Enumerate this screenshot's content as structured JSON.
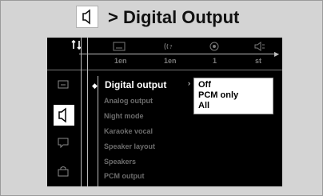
{
  "header": {
    "icon": "speaker-icon",
    "title": "> Digital Output"
  },
  "topbar": {
    "settings_icon": "settings-icon",
    "tabs": [
      {
        "icon": "subtitle-icon",
        "value": "1en"
      },
      {
        "icon": "audio-icon",
        "value": "1en"
      },
      {
        "icon": "angle-icon",
        "value": "1"
      },
      {
        "icon": "sound-icon",
        "value": "st"
      }
    ]
  },
  "sidebar": {
    "items": [
      {
        "icon": "display-icon",
        "selected": false
      },
      {
        "icon": "speaker-icon",
        "selected": true
      },
      {
        "icon": "subtitle-language-icon",
        "selected": false
      },
      {
        "icon": "lock-icon",
        "selected": false
      }
    ]
  },
  "menu": {
    "items": [
      "Digital output",
      "Analog output",
      "Night mode",
      "Karaoke vocal",
      "Speaker layout",
      "Speakers",
      "PCM output"
    ],
    "active_index": 0
  },
  "options": {
    "items": [
      "Off",
      "PCM only",
      "All"
    ],
    "selected_index": 0
  },
  "colors": {
    "background": "#d4d4d4",
    "osd": "#000000",
    "text_active": "#ffffff",
    "text_inactive": "#6c6c6c"
  }
}
